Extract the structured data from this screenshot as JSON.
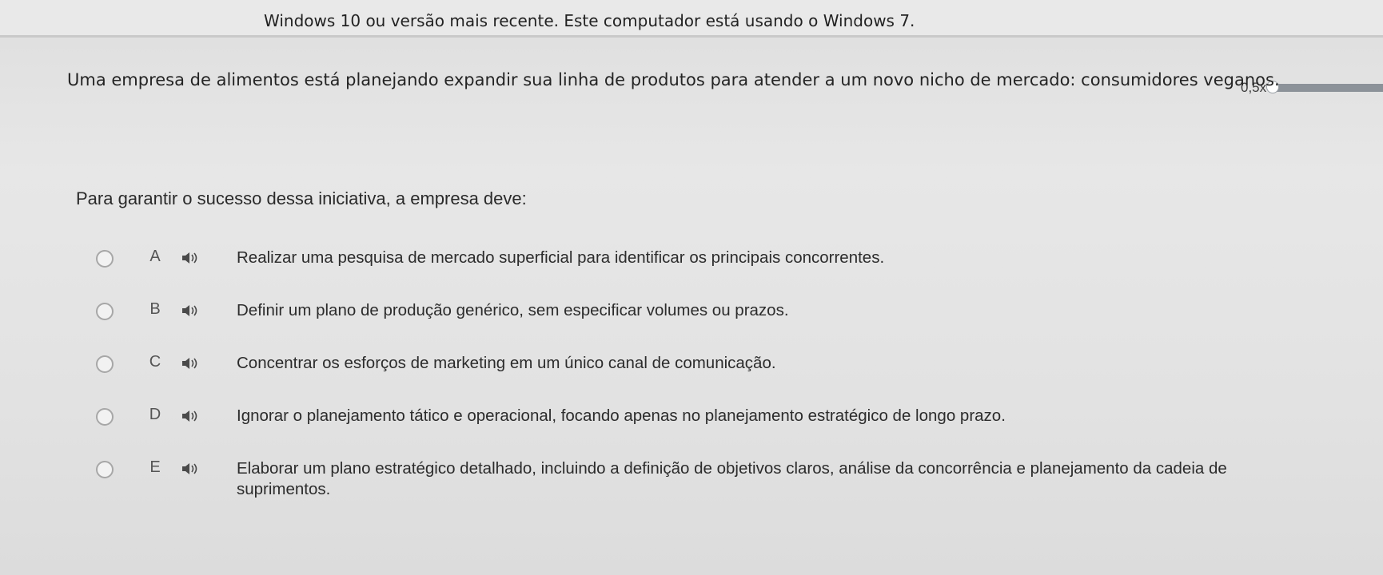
{
  "banner": {
    "text": "Windows 10 ou versão mais recente. Este computador está usando o Windows 7."
  },
  "speed": {
    "label": "0,5x",
    "level": 0.5
  },
  "question": {
    "statement": "Uma empresa de alimentos está planejando expandir sua linha de produtos para atender a um novo nicho de mercado: consumidores veganos.",
    "prompt": "Para garantir o sucesso dessa iniciativa, a empresa deve:"
  },
  "options": [
    {
      "letter": "A",
      "text": "Realizar uma pesquisa de mercado superficial para identificar os principais concorrentes."
    },
    {
      "letter": "B",
      "text": "Definir um plano de produção genérico, sem especificar volumes ou prazos."
    },
    {
      "letter": "C",
      "text": "Concentrar os esforços de marketing em um único canal de comunicação."
    },
    {
      "letter": "D",
      "text": "Ignorar o planejamento tático e operacional, focando apenas no planejamento estratégico de longo prazo."
    },
    {
      "letter": "E",
      "text": "Elaborar um plano estratégico detalhado, incluindo a definição de objetivos claros, análise da concorrência e planejamento da cadeia de suprimentos."
    }
  ],
  "icons": {
    "speaker": "speaker-icon",
    "radio": "radio-button"
  }
}
